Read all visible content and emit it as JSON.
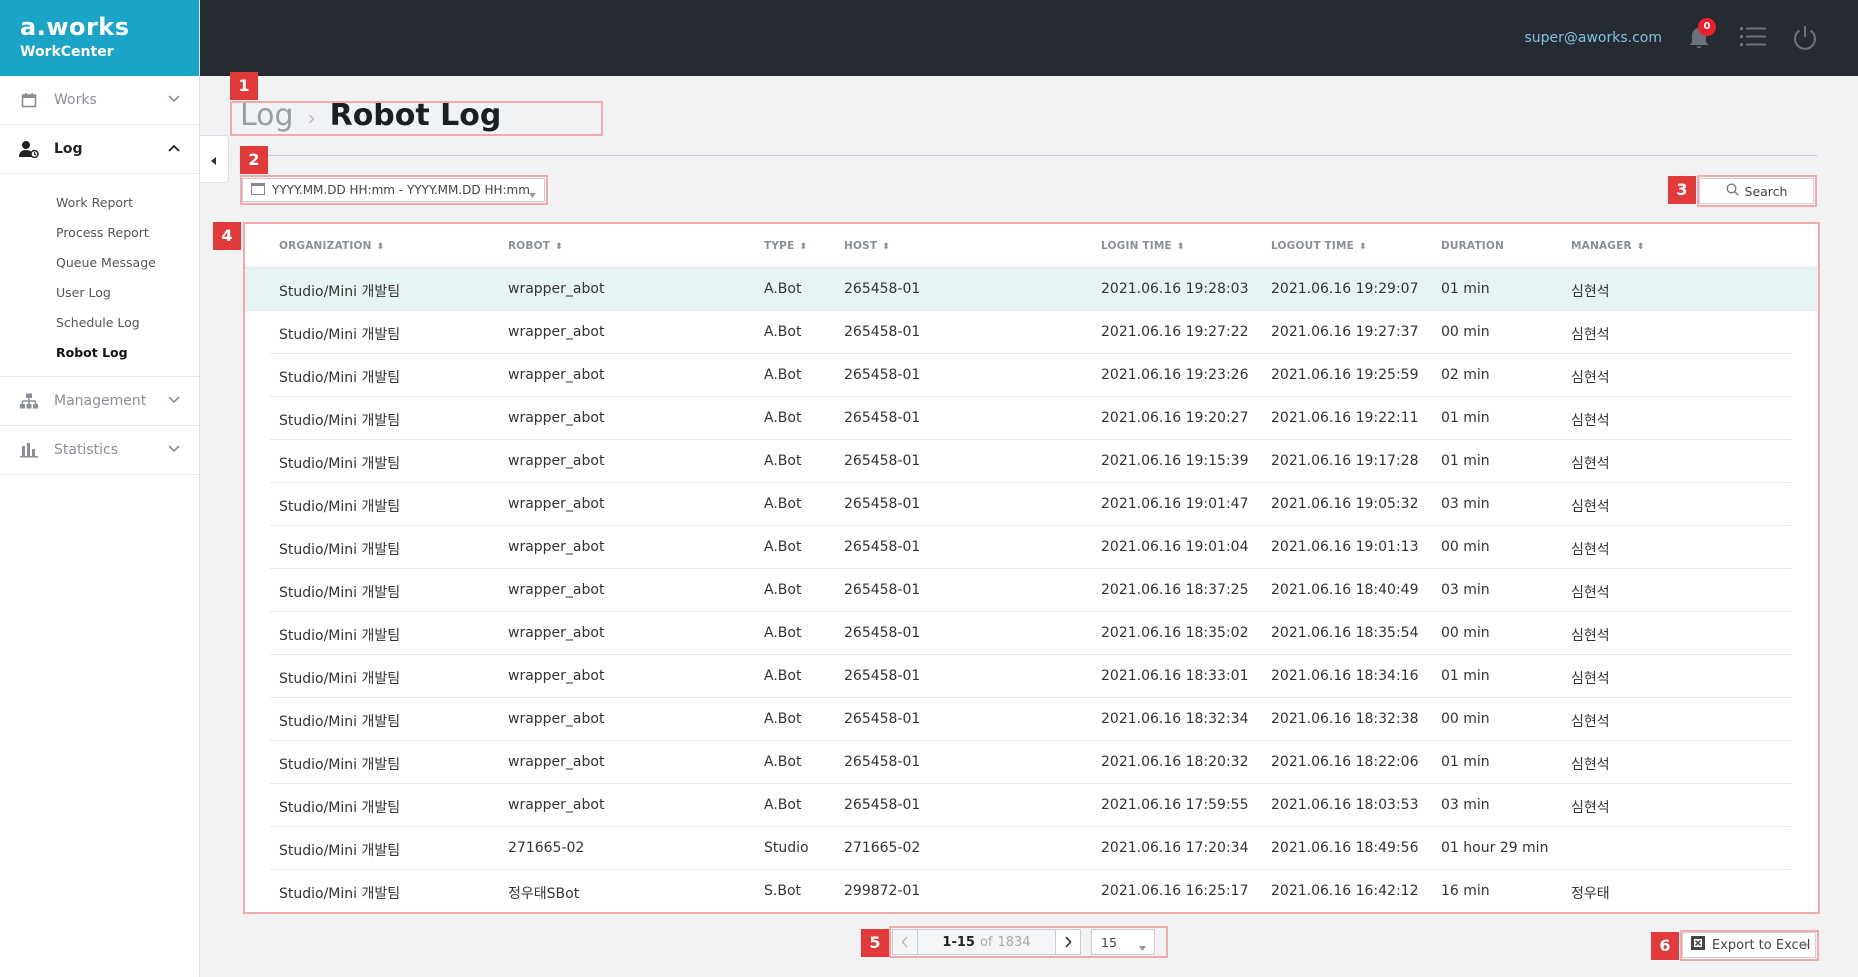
{
  "brand": {
    "logo": "a.works",
    "product": "WorkCenter"
  },
  "header": {
    "user_email": "super@aworks.com",
    "notification_count": "0"
  },
  "sidebar": {
    "items": [
      {
        "label": "Works",
        "icon": "calendar-icon"
      },
      {
        "label": "Log",
        "icon": "user-log-icon"
      },
      {
        "label": "Management",
        "icon": "hierarchy-icon"
      },
      {
        "label": "Statistics",
        "icon": "bar-chart-icon"
      }
    ],
    "log_sub": [
      "Work Report",
      "Process Report",
      "Queue Message",
      "User Log",
      "Schedule Log",
      "Robot Log"
    ]
  },
  "breadcrumb": {
    "parent": "Log",
    "title": "Robot Log"
  },
  "filter": {
    "date_placeholder": "YYYY.MM.DD HH:mm - YYYY.MM.DD HH:mm",
    "search_label": "Search"
  },
  "table": {
    "headers": [
      "ORGANIZATION",
      "ROBOT",
      "TYPE",
      "HOST",
      "LOGIN TIME",
      "LOGOUT TIME",
      "DURATION",
      "MANAGER"
    ],
    "rows": [
      [
        "Studio/Mini 개발팀",
        "wrapper_abot",
        "A.Bot",
        "265458-01",
        "2021.06.16 19:28:03",
        "2021.06.16 19:29:07",
        "01 min",
        "심현석"
      ],
      [
        "Studio/Mini 개발팀",
        "wrapper_abot",
        "A.Bot",
        "265458-01",
        "2021.06.16 19:27:22",
        "2021.06.16 19:27:37",
        "00 min",
        "심현석"
      ],
      [
        "Studio/Mini 개발팀",
        "wrapper_abot",
        "A.Bot",
        "265458-01",
        "2021.06.16 19:23:26",
        "2021.06.16 19:25:59",
        "02 min",
        "심현석"
      ],
      [
        "Studio/Mini 개발팀",
        "wrapper_abot",
        "A.Bot",
        "265458-01",
        "2021.06.16 19:20:27",
        "2021.06.16 19:22:11",
        "01 min",
        "심현석"
      ],
      [
        "Studio/Mini 개발팀",
        "wrapper_abot",
        "A.Bot",
        "265458-01",
        "2021.06.16 19:15:39",
        "2021.06.16 19:17:28",
        "01 min",
        "심현석"
      ],
      [
        "Studio/Mini 개발팀",
        "wrapper_abot",
        "A.Bot",
        "265458-01",
        "2021.06.16 19:01:47",
        "2021.06.16 19:05:32",
        "03 min",
        "심현석"
      ],
      [
        "Studio/Mini 개발팀",
        "wrapper_abot",
        "A.Bot",
        "265458-01",
        "2021.06.16 19:01:04",
        "2021.06.16 19:01:13",
        "00 min",
        "심현석"
      ],
      [
        "Studio/Mini 개발팀",
        "wrapper_abot",
        "A.Bot",
        "265458-01",
        "2021.06.16 18:37:25",
        "2021.06.16 18:40:49",
        "03 min",
        "심현석"
      ],
      [
        "Studio/Mini 개발팀",
        "wrapper_abot",
        "A.Bot",
        "265458-01",
        "2021.06.16 18:35:02",
        "2021.06.16 18:35:54",
        "00 min",
        "심현석"
      ],
      [
        "Studio/Mini 개발팀",
        "wrapper_abot",
        "A.Bot",
        "265458-01",
        "2021.06.16 18:33:01",
        "2021.06.16 18:34:16",
        "01 min",
        "심현석"
      ],
      [
        "Studio/Mini 개발팀",
        "wrapper_abot",
        "A.Bot",
        "265458-01",
        "2021.06.16 18:32:34",
        "2021.06.16 18:32:38",
        "00 min",
        "심현석"
      ],
      [
        "Studio/Mini 개발팀",
        "wrapper_abot",
        "A.Bot",
        "265458-01",
        "2021.06.16 18:20:32",
        "2021.06.16 18:22:06",
        "01 min",
        "심현석"
      ],
      [
        "Studio/Mini 개발팀",
        "wrapper_abot",
        "A.Bot",
        "265458-01",
        "2021.06.16 17:59:55",
        "2021.06.16 18:03:53",
        "03 min",
        "심현석"
      ],
      [
        "Studio/Mini 개발팀",
        "271665-02",
        "Studio",
        "271665-02",
        "2021.06.16 17:20:34",
        "2021.06.16 18:49:56",
        "01 hour 29 min",
        ""
      ],
      [
        "Studio/Mini 개발팀",
        "정우태SBot",
        "S.Bot",
        "299872-01",
        "2021.06.16 16:25:17",
        "2021.06.16 16:42:12",
        "16 min",
        "정우태"
      ]
    ]
  },
  "pagination": {
    "range": "1-15",
    "of": "of",
    "total": "1834",
    "page_size": "15"
  },
  "export": {
    "label": "Export to Excel"
  },
  "annotations": [
    "1",
    "2",
    "3",
    "4",
    "5",
    "6"
  ],
  "colors": {
    "brand": "#1aa4c8",
    "topbar": "#262a31",
    "highlight_row": "#e6f4f3",
    "annotation": "#e23a3a"
  }
}
